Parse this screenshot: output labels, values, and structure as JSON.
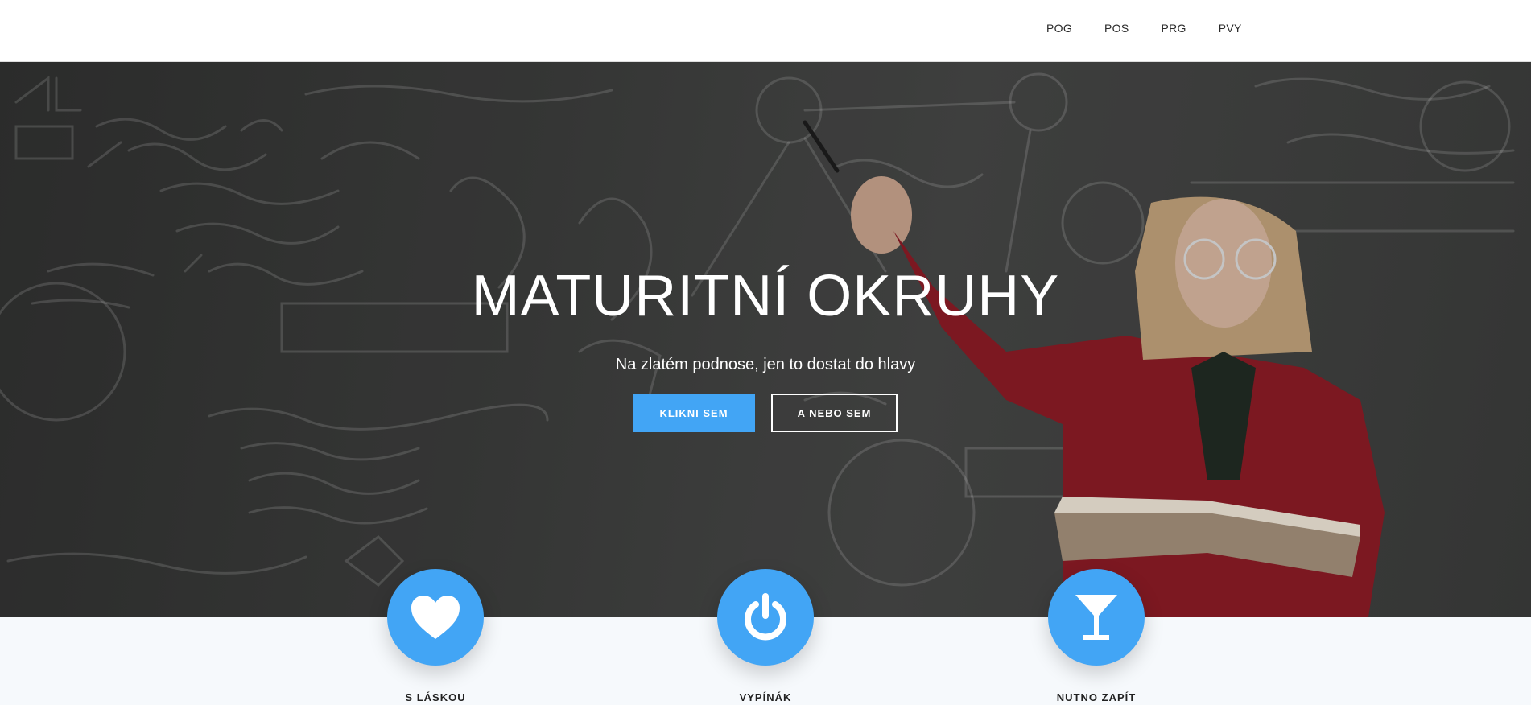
{
  "nav": {
    "links": [
      "POG",
      "POS",
      "PRG",
      "PVY"
    ]
  },
  "hero": {
    "title": "MATURITNÍ OKRUHY",
    "subtitle": "Na zlatém podnose, jen to dostat do hlavy",
    "primary_button": "KLIKNI SEM",
    "secondary_button": "A NEBO SEM"
  },
  "features": [
    {
      "label": "S LÁSKOU",
      "icon": "heart-icon"
    },
    {
      "label": "VYPÍNÁK",
      "icon": "power-icon"
    },
    {
      "label": "NUTNO ZAPÍT",
      "icon": "cocktail-icon"
    }
  ],
  "colors": {
    "accent": "#42a5f5",
    "features_bg": "#f6f9fc"
  }
}
